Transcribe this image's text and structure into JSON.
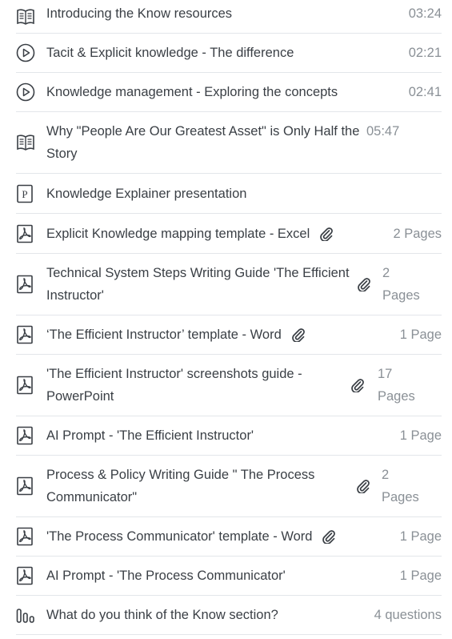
{
  "items": [
    {
      "type": "book",
      "title": "Introducing the Know resources",
      "meta": "03:24",
      "attachment": false
    },
    {
      "type": "video",
      "title": "Tacit & Explicit knowledge - The difference",
      "meta": "02:21",
      "attachment": false
    },
    {
      "type": "video",
      "title": "Knowledge management - Exploring the concepts",
      "meta": "02:41",
      "attachment": false
    },
    {
      "type": "book",
      "title": "Why \"People Are Our Greatest Asset\" is Only Half the Story",
      "meta": "05:47",
      "attachment": false
    },
    {
      "type": "presentation",
      "title": "Knowledge Explainer presentation",
      "meta": "",
      "attachment": false
    },
    {
      "type": "pdf",
      "title": "Explicit Knowledge mapping template - Excel",
      "meta": "2 Pages",
      "attachment": true
    },
    {
      "type": "pdf",
      "title": "Technical System Steps Writing Guide 'The Efficient Instructor'",
      "meta": "2 Pages",
      "attachment": true
    },
    {
      "type": "pdf",
      "title": "‘The Efficient Instructor’ template - Word",
      "meta": "1 Page",
      "attachment": true
    },
    {
      "type": "pdf",
      "title": "'The Efficient Instructor' screenshots guide - PowerPoint",
      "meta": "17 Pages",
      "attachment": true
    },
    {
      "type": "pdf",
      "title": "AI Prompt - 'The Efficient Instructor'",
      "meta": "1 Page",
      "attachment": false
    },
    {
      "type": "pdf",
      "title": "Process & Policy Writing Guide \" The Process Communicator\"",
      "meta": "2 Pages",
      "attachment": true
    },
    {
      "type": "pdf",
      "title": "'The Process Communicator' template - Word",
      "meta": "1 Page",
      "attachment": true
    },
    {
      "type": "pdf",
      "title": "AI Prompt - 'The Process Communicator'",
      "meta": "1 Page",
      "attachment": false
    },
    {
      "type": "survey",
      "title": "What do you think of the Know section?",
      "meta": "4 questions",
      "attachment": false
    }
  ],
  "icons": {
    "book": "open-book-icon",
    "video": "play-circle-icon",
    "presentation": "presentation-icon",
    "pdf": "pdf-file-icon",
    "survey": "survey-chart-icon",
    "attachment": "paperclip-icon"
  },
  "colors": {
    "text": "#3a3f45",
    "muted": "#8a9096",
    "divider": "#e3e6ea",
    "icon": "#3a3f45"
  }
}
